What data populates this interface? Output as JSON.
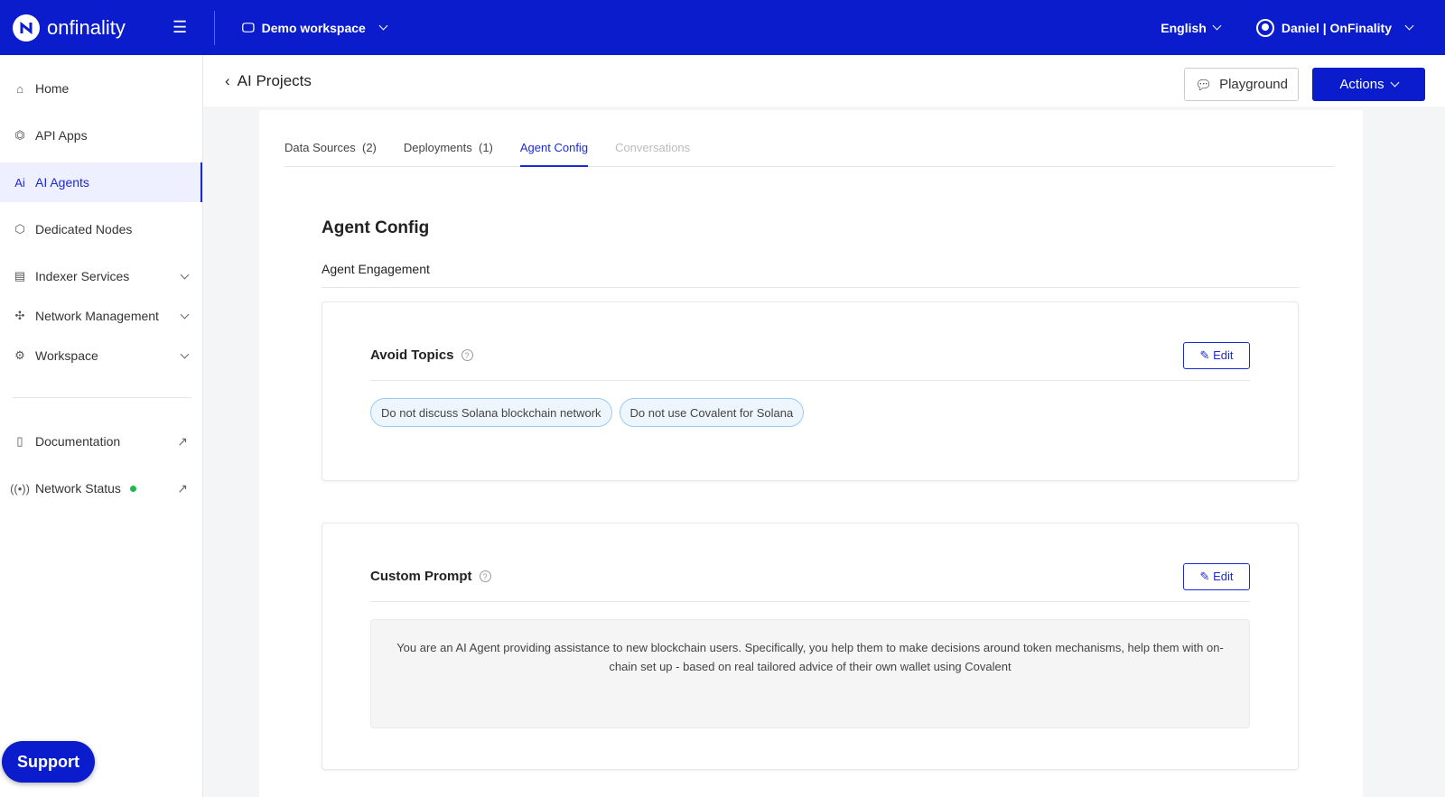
{
  "topbar": {
    "brand": "onfinality",
    "workspace": "Demo workspace",
    "language": "English",
    "user": "Daniel | OnFinality"
  },
  "sidebar": {
    "items": [
      {
        "label": "Home"
      },
      {
        "label": "API Apps"
      },
      {
        "label": "AI Agents"
      },
      {
        "label": "Dedicated Nodes"
      },
      {
        "label": "Indexer Services"
      },
      {
        "label": "Network Management"
      },
      {
        "label": "Workspace"
      },
      {
        "label": "Documentation"
      },
      {
        "label": "Network Status"
      }
    ],
    "support": "Support"
  },
  "header": {
    "back": "AI Projects",
    "playground": "Playground",
    "actions": "Actions"
  },
  "tabs": [
    {
      "label": "Data Sources",
      "count": "(2)"
    },
    {
      "label": "Deployments",
      "count": "(1)"
    },
    {
      "label": "Agent Config"
    },
    {
      "label": "Conversations"
    }
  ],
  "main": {
    "title": "Agent Config",
    "subtitle": "Agent Engagement",
    "avoid": {
      "title": "Avoid Topics",
      "edit": "Edit",
      "tags": [
        "Do not discuss Solana blockchain network",
        "Do not use Covalent for Solana"
      ]
    },
    "prompt": {
      "title": "Custom Prompt",
      "edit": "Edit",
      "text": "You are an AI Agent providing assistance to new blockchain users. Specifically, you help them to make decisions around token mechanisms, help them with on-chain set up - based on real tailored advice of their own wallet using Covalent"
    }
  }
}
